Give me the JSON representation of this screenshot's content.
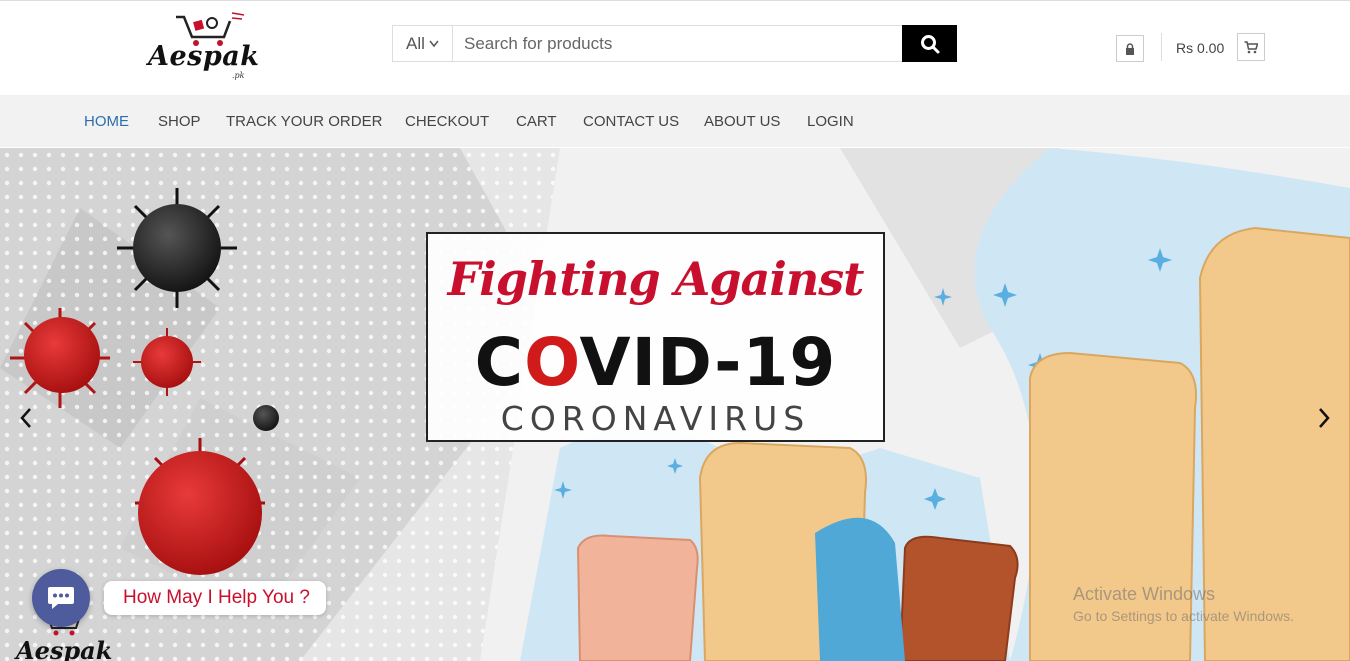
{
  "header": {
    "logo_text": "Aespak",
    "logo_sub": ".pk"
  },
  "search": {
    "category": "All",
    "placeholder": "Search for products"
  },
  "header_actions": {
    "cart_total": "Rs 0.00"
  },
  "nav": {
    "items": [
      {
        "label": "HOME"
      },
      {
        "label": "SHOP"
      },
      {
        "label": "TRACK YOUR ORDER"
      },
      {
        "label": "CHECKOUT"
      },
      {
        "label": "CART"
      },
      {
        "label": "CONTACT US"
      },
      {
        "label": "ABOUT US"
      },
      {
        "label": "LOGIN"
      }
    ]
  },
  "hero": {
    "line1": "Fighting Against",
    "line2_pre": "C",
    "line2_o": "O",
    "line2_post": "VID-19",
    "line3": "CORONAVIRUS"
  },
  "chat": {
    "label": "How May I Help You ?"
  },
  "system_overlay": {
    "title": "Activate Windows",
    "subtitle": "Go to Settings to activate Windows."
  },
  "colors": {
    "nav_active": "#2a6fad",
    "brand_red": "#c8102e",
    "chat_bubble": "#4e5b9c",
    "search_button": "#000000"
  },
  "icons": {
    "search": "search-icon",
    "lock": "lock-icon",
    "cart": "cart-icon",
    "prev": "chevron-left-icon",
    "next": "chevron-right-icon",
    "chat": "chat-icon",
    "dropdown": "chevron-down-icon"
  }
}
